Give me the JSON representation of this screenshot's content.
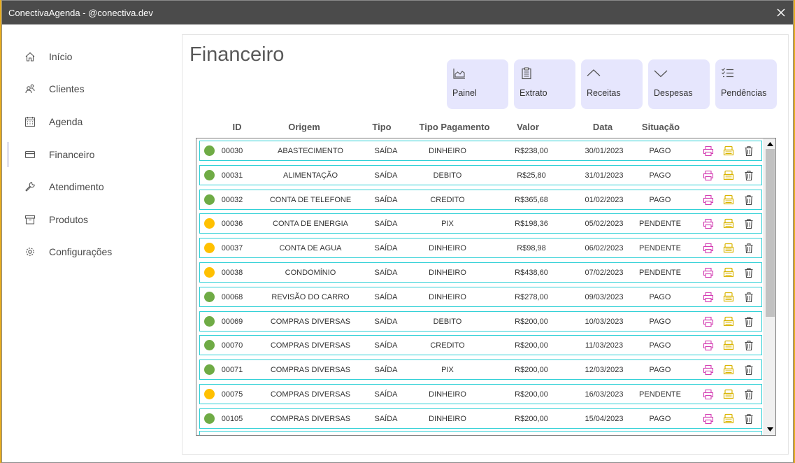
{
  "window": {
    "title": "ConectivaAgenda  - @conectiva.dev"
  },
  "sidebar": {
    "items": [
      {
        "label": "Início",
        "icon": "home-icon"
      },
      {
        "label": "Clientes",
        "icon": "users-icon"
      },
      {
        "label": "Agenda",
        "icon": "calendar-icon"
      },
      {
        "label": "Financeiro",
        "icon": "card-icon",
        "active": true
      },
      {
        "label": "Atendimento",
        "icon": "wrench-icon"
      },
      {
        "label": "Produtos",
        "icon": "box-icon"
      },
      {
        "label": "Configurações",
        "icon": "gear-icon"
      }
    ]
  },
  "main": {
    "title": "Financeiro",
    "tiles": [
      {
        "label": "Painel",
        "icon": "area-chart-icon"
      },
      {
        "label": "Extrato",
        "icon": "clipboard-icon"
      },
      {
        "label": "Receitas",
        "icon": "chevron-up-icon"
      },
      {
        "label": "Despesas",
        "icon": "chevron-down-icon"
      },
      {
        "label": "Pendências",
        "icon": "checklist-icon"
      }
    ],
    "columns": {
      "id": "ID",
      "origem": "Origem",
      "tipo": "Tipo",
      "tipo_pagamento": "Tipo Pagamento",
      "valor": "Valor",
      "data": "Data",
      "situacao": "Situação"
    }
  },
  "status_colors": {
    "PAGO": "#6fab45",
    "PENDENTE": "#ffc000"
  },
  "action_colors": {
    "print": "#d43fb3",
    "edit": "#d9b400",
    "delete": "#444444"
  },
  "transactions": [
    {
      "id": "00030",
      "origem": "ABASTECIMENTO",
      "tipo": "SAÍDA",
      "pagamento": "DINHEIRO",
      "valor": "R$238,00",
      "data": "30/01/2023",
      "situacao": "PAGO"
    },
    {
      "id": "00031",
      "origem": "ALIMENTAÇÃO",
      "tipo": "SAÍDA",
      "pagamento": "DEBITO",
      "valor": "R$25,80",
      "data": "31/01/2023",
      "situacao": "PAGO"
    },
    {
      "id": "00032",
      "origem": "CONTA DE TELEFONE",
      "tipo": "SAÍDA",
      "pagamento": "CREDITO",
      "valor": "R$365,68",
      "data": "01/02/2023",
      "situacao": "PAGO"
    },
    {
      "id": "00036",
      "origem": "CONTA DE ENERGIA",
      "tipo": "SAÍDA",
      "pagamento": "PIX",
      "valor": "R$198,36",
      "data": "05/02/2023",
      "situacao": "PENDENTE"
    },
    {
      "id": "00037",
      "origem": "CONTA DE AGUA",
      "tipo": "SAÍDA",
      "pagamento": "DINHEIRO",
      "valor": "R$98,98",
      "data": "06/02/2023",
      "situacao": "PENDENTE"
    },
    {
      "id": "00038",
      "origem": "CONDOMÍNIO",
      "tipo": "SAÍDA",
      "pagamento": "DINHEIRO",
      "valor": "R$438,60",
      "data": "07/02/2023",
      "situacao": "PENDENTE"
    },
    {
      "id": "00068",
      "origem": "REVISÃO DO CARRO",
      "tipo": "SAÍDA",
      "pagamento": "DINHEIRO",
      "valor": "R$278,00",
      "data": "09/03/2023",
      "situacao": "PAGO"
    },
    {
      "id": "00069",
      "origem": "COMPRAS DIVERSAS",
      "tipo": "SAÍDA",
      "pagamento": "DEBITO",
      "valor": "R$200,00",
      "data": "10/03/2023",
      "situacao": "PAGO"
    },
    {
      "id": "00070",
      "origem": "COMPRAS DIVERSAS",
      "tipo": "SAÍDA",
      "pagamento": "CREDITO",
      "valor": "R$200,00",
      "data": "11/03/2023",
      "situacao": "PAGO"
    },
    {
      "id": "00071",
      "origem": "COMPRAS DIVERSAS",
      "tipo": "SAÍDA",
      "pagamento": "PIX",
      "valor": "R$200,00",
      "data": "12/03/2023",
      "situacao": "PAGO"
    },
    {
      "id": "00075",
      "origem": "COMPRAS DIVERSAS",
      "tipo": "SAÍDA",
      "pagamento": "DINHEIRO",
      "valor": "R$200,00",
      "data": "16/03/2023",
      "situacao": "PENDENTE"
    },
    {
      "id": "00105",
      "origem": "COMPRAS DIVERSAS",
      "tipo": "SAÍDA",
      "pagamento": "DINHEIRO",
      "valor": "R$200,00",
      "data": "15/04/2023",
      "situacao": "PAGO"
    }
  ]
}
